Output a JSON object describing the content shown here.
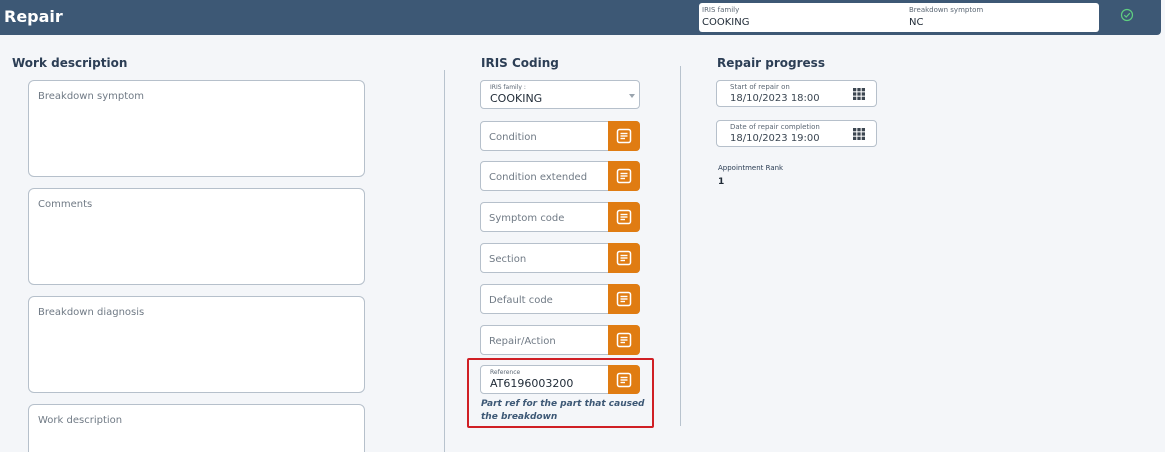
{
  "header": {
    "title": "Repair",
    "iris_family_label": "IRIS family",
    "iris_family_value": "COOKING",
    "breakdown_symptom_label": "Breakdown symptom",
    "breakdown_symptom_value": "NC",
    "status_icon": "check-circle-icon"
  },
  "work_description": {
    "title": "Work description",
    "fields": [
      {
        "placeholder": "Breakdown symptom"
      },
      {
        "placeholder": "Comments"
      },
      {
        "placeholder": "Breakdown diagnosis"
      },
      {
        "placeholder": "Work description"
      }
    ]
  },
  "iris_coding": {
    "title": "IRIS Coding",
    "family_label": "IRIS family :",
    "family_value": "COOKING",
    "fields": [
      {
        "label": "Condition"
      },
      {
        "label": "Condition extended"
      },
      {
        "label": "Symptom code"
      },
      {
        "label": "Section"
      },
      {
        "label": "Default code"
      },
      {
        "label": "Repair/Action"
      }
    ],
    "reference_label": "Reference",
    "reference_value": "AT6196003200",
    "reference_hint": "Part ref for the part that caused the breakdown",
    "button_icon": "list-icon",
    "accent_color": "#e07c12",
    "highlight_color": "#d01f25"
  },
  "repair_progress": {
    "title": "Repair progress",
    "start_label": "Start of repair on",
    "start_value": "18/10/2023 18:00",
    "completion_label": "Date of repair completion",
    "completion_value": "18/10/2023 19:00",
    "rank_label": "Appointment Rank",
    "rank_value": "1",
    "calendar_icon": "calendar-grid-icon"
  },
  "colors": {
    "header_bg": "#3d5875",
    "page_bg": "#f4f6f9"
  }
}
